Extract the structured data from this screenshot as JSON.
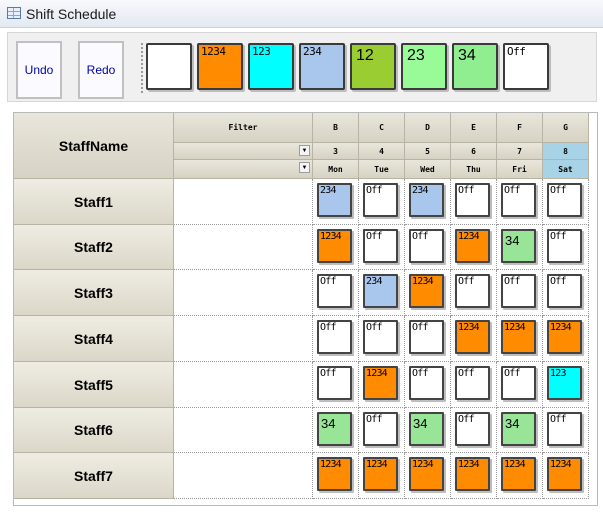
{
  "window": {
    "title": "Shift Schedule",
    "icon": "grid-app-icon"
  },
  "toolbar": {
    "undo_label": "Undo",
    "redo_label": "Redo",
    "palette": [
      {
        "code": "blank",
        "label": "",
        "color": "#ffffff"
      },
      {
        "code": "1234",
        "label": "1234",
        "color": "#ff8c00"
      },
      {
        "code": "123",
        "label": "123",
        "color": "#00ffff"
      },
      {
        "code": "234",
        "label": "234",
        "color": "#a9c6ec"
      },
      {
        "code": "12",
        "label": "12",
        "color": "#9acd32"
      },
      {
        "code": "23",
        "label": "23",
        "color": "#98fb98"
      },
      {
        "code": "34",
        "label": "34",
        "color": "#90ee90"
      },
      {
        "code": "Off",
        "label": "Off",
        "color": "#ffffff"
      }
    ]
  },
  "grid": {
    "header": {
      "staffname_label": "StaffName",
      "filter_label": "Filter",
      "columns": [
        {
          "letter": "B",
          "date": "3",
          "day": "Mon"
        },
        {
          "letter": "C",
          "date": "4",
          "day": "Tue"
        },
        {
          "letter": "D",
          "date": "5",
          "day": "Wed"
        },
        {
          "letter": "E",
          "date": "6",
          "day": "Thu"
        },
        {
          "letter": "F",
          "date": "7",
          "day": "Fri"
        },
        {
          "letter": "G",
          "date": "8",
          "day": "Sat",
          "selected": true
        }
      ]
    },
    "shift_colors": {
      "1234": "#ff8c00",
      "123": "#00ffff",
      "234": "#a9c6ec",
      "34": "#98e598",
      "Off": "#ffffff"
    },
    "rows": [
      {
        "name": "Staff1",
        "shifts": [
          "234",
          "Off",
          "234",
          "Off",
          "Off",
          "Off"
        ]
      },
      {
        "name": "Staff2",
        "shifts": [
          "1234",
          "Off",
          "Off",
          "1234",
          "34",
          "Off"
        ]
      },
      {
        "name": "Staff3",
        "shifts": [
          "Off",
          "234",
          "1234",
          "Off",
          "Off",
          "Off"
        ]
      },
      {
        "name": "Staff4",
        "shifts": [
          "Off",
          "Off",
          "Off",
          "1234",
          "1234",
          "1234"
        ]
      },
      {
        "name": "Staff5",
        "shifts": [
          "Off",
          "1234",
          "Off",
          "Off",
          "Off",
          "123"
        ]
      },
      {
        "name": "Staff6",
        "shifts": [
          "34",
          "Off",
          "34",
          "Off",
          "34",
          "Off"
        ]
      },
      {
        "name": "Staff7",
        "shifts": [
          "1234",
          "1234",
          "1234",
          "1234",
          "1234",
          "1234"
        ]
      }
    ]
  }
}
